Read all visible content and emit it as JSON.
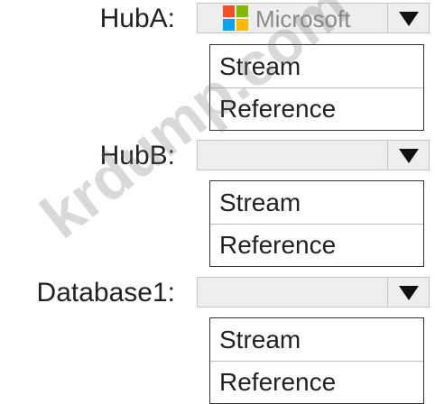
{
  "hub_a": {
    "label": "HubA:",
    "selected_text": "Microsoft",
    "options": [
      "Stream",
      "Reference"
    ]
  },
  "hub_b": {
    "label": "HubB:",
    "selected_text": "",
    "options": [
      "Stream",
      "Reference"
    ]
  },
  "database1": {
    "label": "Database1:",
    "selected_text": "",
    "options": [
      "Stream",
      "Reference"
    ]
  },
  "watermark": "krdump.com",
  "colors": {
    "ms_red": "#f25022",
    "ms_green": "#7fba00",
    "ms_blue": "#00a4ef",
    "ms_yellow": "#ffb900"
  },
  "icons": {
    "dropdown": "triangle-down-icon",
    "logo": "microsoft-logo-icon"
  }
}
